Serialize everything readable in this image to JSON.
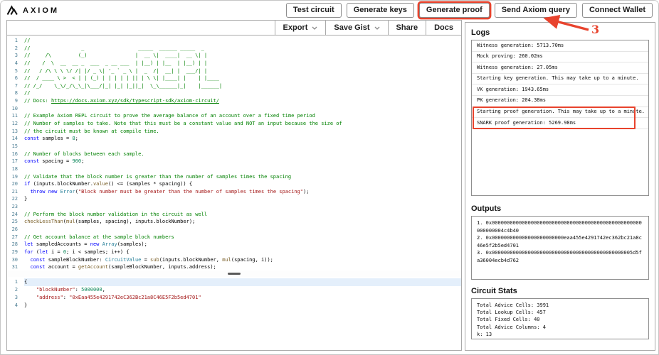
{
  "header": {
    "logo_text": "AXIOM",
    "buttons": [
      {
        "label": "Test circuit",
        "annotated": false
      },
      {
        "label": "Generate keys",
        "annotated": false
      },
      {
        "label": "Generate proof",
        "annotated": true
      },
      {
        "label": "Send Axiom query",
        "annotated": false
      },
      {
        "label": "Connect Wallet",
        "annotated": false
      }
    ]
  },
  "annotation": {
    "step_label": "3",
    "color": "#e8432d"
  },
  "editor_toolbar": {
    "items": [
      {
        "label": "Export",
        "chevron": true
      },
      {
        "label": "Save Gist",
        "chevron": true
      },
      {
        "label": "Share",
        "chevron": false
      },
      {
        "label": "Docs",
        "chevron": false
      }
    ]
  },
  "code_editor": {
    "lines": [
      {
        "n": 1,
        "t": [
          [
            "c",
            "//"
          ]
        ]
      },
      {
        "n": 2,
        "t": [
          [
            "c",
            "//                 _                  _____  ______ _____  _"
          ]
        ]
      },
      {
        "n": 3,
        "t": [
          [
            "c",
            "//     /\\         (_)                |  __ \\|  ____|  __ \\| |"
          ]
        ]
      },
      {
        "n": 4,
        "t": [
          [
            "c",
            "//    /  \\  __  __ _  ___  _ __ ___  | |__) | |__  | |__) | |"
          ]
        ]
      },
      {
        "n": 5,
        "t": [
          [
            "c",
            "//   / /\\ \\ \\ \\/ /| |/ _ \\| '_ ` _ \\ |  _  /|  __| |  ___/| |"
          ]
        ]
      },
      {
        "n": 6,
        "t": [
          [
            "c",
            "//  / ____ \\ >  < | | (_) | | | | | || | \\ \\| |____| |    | |____"
          ]
        ]
      },
      {
        "n": 7,
        "t": [
          [
            "c",
            "// /_/    \\_\\/_/\\_\\_|\\___/|_| |_| |_||_|  \\_\\______|_|    |______|"
          ]
        ]
      },
      {
        "n": 8,
        "t": [
          [
            "c",
            "//"
          ]
        ]
      },
      {
        "n": 9,
        "t": [
          [
            "c",
            "// Docs: "
          ],
          [
            "cl",
            "https://docs.axiom.xyz/sdk/typescript-sdk/axiom-circuit/"
          ]
        ]
      },
      {
        "n": 10,
        "t": []
      },
      {
        "n": 11,
        "t": [
          [
            "c",
            "// Example Axiom REPL circuit to prove the average balance of an account over a fixed time period"
          ]
        ]
      },
      {
        "n": 12,
        "t": [
          [
            "c",
            "// Number of samples to take. Note that this must be a constant value and NOT an input because the size of"
          ]
        ]
      },
      {
        "n": 13,
        "t": [
          [
            "c",
            "// the circuit must be known at compile time."
          ]
        ]
      },
      {
        "n": 14,
        "t": [
          [
            "k",
            "const"
          ],
          [
            "p",
            " samples = "
          ],
          [
            "n",
            "8"
          ],
          [
            "p",
            ";"
          ]
        ]
      },
      {
        "n": 15,
        "t": []
      },
      {
        "n": 16,
        "t": [
          [
            "c",
            "// Number of blocks between each sample."
          ]
        ]
      },
      {
        "n": 17,
        "t": [
          [
            "k",
            "const"
          ],
          [
            "p",
            " spacing = "
          ],
          [
            "n",
            "900"
          ],
          [
            "p",
            ";"
          ]
        ]
      },
      {
        "n": 18,
        "t": []
      },
      {
        "n": 19,
        "t": [
          [
            "c",
            "// Validate that the block number is greater than the number of samples times the spacing"
          ]
        ]
      },
      {
        "n": 20,
        "t": [
          [
            "k",
            "if"
          ],
          [
            "p",
            " (inputs.blockNumber."
          ],
          [
            "f",
            "value"
          ],
          [
            "p",
            "() <= (samples * spacing)) {"
          ]
        ]
      },
      {
        "n": 21,
        "t": [
          [
            "p",
            "  "
          ],
          [
            "k",
            "throw"
          ],
          [
            "p",
            " "
          ],
          [
            "k",
            "new"
          ],
          [
            "p",
            " "
          ],
          [
            "t",
            "Error"
          ],
          [
            "p",
            "("
          ],
          [
            "s",
            "\"Block number must be greater than the number of samples times the spacing\""
          ],
          [
            "p",
            ");"
          ]
        ]
      },
      {
        "n": 22,
        "t": [
          [
            "p",
            "}"
          ]
        ]
      },
      {
        "n": 23,
        "t": []
      },
      {
        "n": 24,
        "t": [
          [
            "c",
            "// Perform the block number validation in the circuit as well"
          ]
        ]
      },
      {
        "n": 25,
        "t": [
          [
            "f",
            "checkLessThan"
          ],
          [
            "p",
            "("
          ],
          [
            "f",
            "mul"
          ],
          [
            "p",
            "(samples, spacing), inputs.blockNumber);"
          ]
        ]
      },
      {
        "n": 26,
        "t": []
      },
      {
        "n": 27,
        "t": [
          [
            "c",
            "// Get account balance at the sample block numbers"
          ]
        ]
      },
      {
        "n": 28,
        "t": [
          [
            "k",
            "let"
          ],
          [
            "p",
            " sampledAccounts = "
          ],
          [
            "k",
            "new"
          ],
          [
            "p",
            " "
          ],
          [
            "t",
            "Array"
          ],
          [
            "p",
            "(samples);"
          ]
        ]
      },
      {
        "n": 29,
        "t": [
          [
            "k",
            "for"
          ],
          [
            "p",
            " ("
          ],
          [
            "k",
            "let"
          ],
          [
            "p",
            " i = "
          ],
          [
            "n",
            "0"
          ],
          [
            "p",
            "; i < samples; i++) {"
          ]
        ]
      },
      {
        "n": 30,
        "t": [
          [
            "p",
            "  "
          ],
          [
            "k",
            "const"
          ],
          [
            "p",
            " sampleBlockNumber: "
          ],
          [
            "t",
            "CircuitValue"
          ],
          [
            "p",
            " = "
          ],
          [
            "f",
            "sub"
          ],
          [
            "p",
            "(inputs.blockNumber, "
          ],
          [
            "f",
            "mul"
          ],
          [
            "p",
            "(spacing, i));"
          ]
        ]
      },
      {
        "n": 31,
        "t": [
          [
            "p",
            "  "
          ],
          [
            "k",
            "const"
          ],
          [
            "p",
            " account = "
          ],
          [
            "f",
            "getAccount"
          ],
          [
            "p",
            "(sampleBlockNumber, inputs.address);"
          ]
        ]
      }
    ]
  },
  "input_editor": {
    "lines": [
      {
        "n": 1,
        "highlight": true,
        "t": [
          [
            "p",
            "{"
          ]
        ]
      },
      {
        "n": 2,
        "highlight": false,
        "t": [
          [
            "p",
            "    "
          ],
          [
            "s",
            "\"blockNumber\""
          ],
          [
            "p",
            ": "
          ],
          [
            "n",
            "5000000"
          ],
          [
            "p",
            ","
          ]
        ]
      },
      {
        "n": 3,
        "highlight": false,
        "t": [
          [
            "p",
            "    "
          ],
          [
            "s",
            "\"address\""
          ],
          [
            "p",
            ": "
          ],
          [
            "s",
            "\"0xEaa455e4291742eC362Bc21a8C46E5F2b5ed4701\""
          ]
        ]
      },
      {
        "n": 4,
        "highlight": false,
        "t": [
          [
            "p",
            "}"
          ]
        ]
      }
    ]
  },
  "right_panel": {
    "logs": {
      "title": "Logs",
      "entries": [
        {
          "text": "Witness generation: 5713.70ms",
          "boxed": false
        },
        {
          "text": "Mock proving: 260.02ms",
          "boxed": false
        },
        {
          "text": "Witness generation: 27.05ms",
          "boxed": false
        },
        {
          "text": "Starting key generation. This may take up to a minute.",
          "boxed": false
        },
        {
          "text": "VK generation: 1943.65ms",
          "boxed": false
        },
        {
          "text": "PK generation: 204.38ms",
          "boxed": false
        },
        {
          "text": "Starting proof generation. This may take up to a minute.",
          "boxed": true
        },
        {
          "text": "SNARK proof generation: 5269.98ms",
          "boxed": true
        }
      ]
    },
    "outputs": {
      "title": "Outputs",
      "items": [
        {
          "n": "1.",
          "hex": "0x00000000000000000000000000000000000000000000000000000000004c4b40"
        },
        {
          "n": "2.",
          "hex": "0x000000000000000000000000eaa455e4291742ec362bc21a8c46e5f2b5ed4701"
        },
        {
          "n": "3.",
          "hex": "0x00000000000000000000000000000000000000000000005d5fa36004ecb4d762"
        }
      ]
    },
    "circuit_stats": {
      "title": "Circuit Stats",
      "lines": [
        "Total Advice Cells: 3991",
        "Total Lookup Cells: 457",
        "Total Fixed Cells: 40",
        "Total Advice Columns: 4",
        "k: 13"
      ]
    }
  },
  "colors": {
    "annotation_red": "#e8432d",
    "comment_green": "#008000",
    "keyword_blue": "#0000ff",
    "string_red": "#a31515",
    "number_green": "#098658",
    "type_teal": "#267f99",
    "function_brown": "#795e26",
    "highlight_line": "#e4effb"
  }
}
